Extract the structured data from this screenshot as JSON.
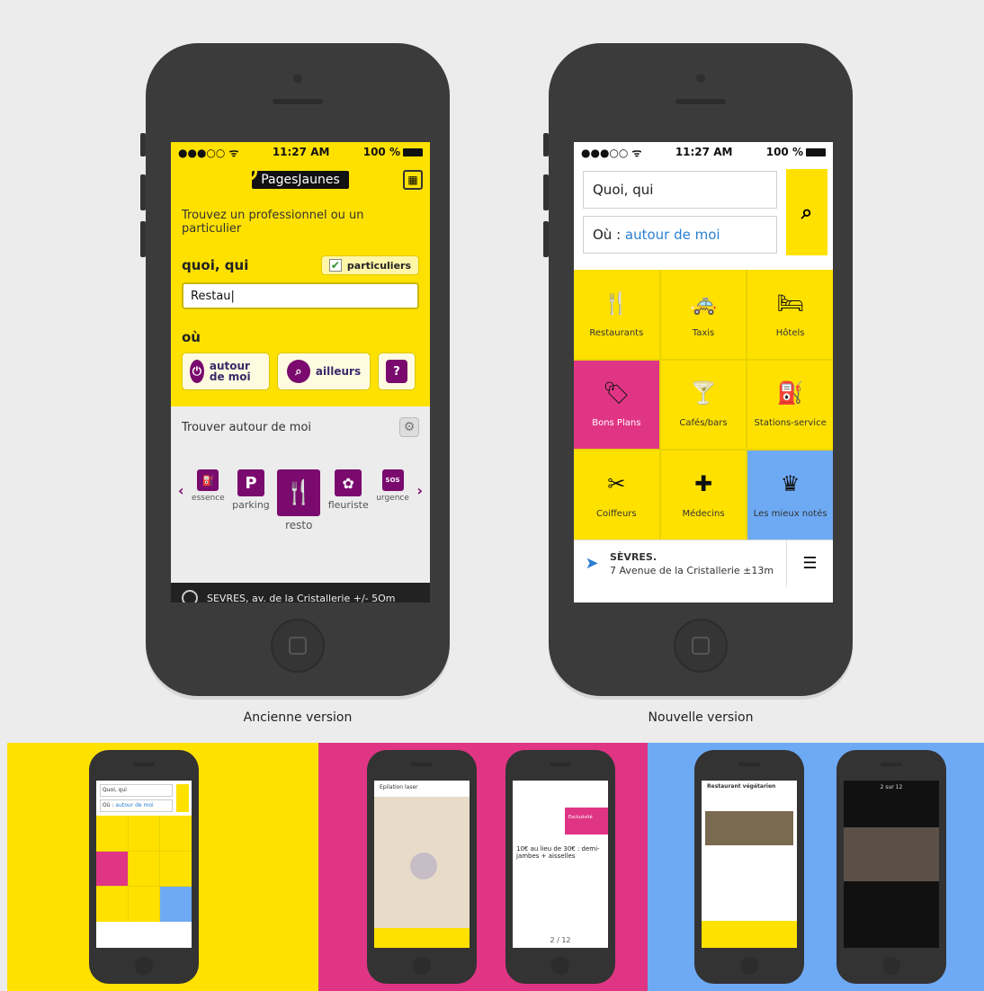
{
  "old_version": {
    "caption": "Ancienne version",
    "status": {
      "time": "11:27 AM",
      "battery": "100 %"
    },
    "logo": "PagesJaunes",
    "lead": "Trouvez un professionnel ou un particulier",
    "what_label": "quoi, qui",
    "checkbox_label": "particuliers",
    "query_value": "Restau",
    "where_label": "où",
    "buttons": [
      {
        "label": "autour de moi"
      },
      {
        "label": "ailleurs"
      },
      {
        "label": "?"
      }
    ],
    "nearby_title": "Trouver autour de moi",
    "categories": [
      {
        "label": "essence",
        "glyph": "⛽"
      },
      {
        "label": "parking",
        "glyph": "P"
      },
      {
        "label": "resto",
        "glyph": "🍴"
      },
      {
        "label": "fleuriste",
        "glyph": "✿"
      },
      {
        "label": "urgence",
        "glyph": "SOS"
      }
    ],
    "footer_location": "SEVRES, av. de la Cristallerie +/- 5Om"
  },
  "new_version": {
    "caption": "Nouvelle version",
    "status": {
      "time": "11:27 AM",
      "battery": "100 %"
    },
    "what_placeholder": "Quoi, qui",
    "where_prefix": "Où :",
    "where_value": "autour de moi",
    "tiles": [
      {
        "label": "Restaurants",
        "icon": "fork-knife-icon",
        "glyph": "🍴",
        "color": "#ffe100"
      },
      {
        "label": "Taxis",
        "icon": "taxi-icon",
        "glyph": "🚕",
        "color": "#ffe100"
      },
      {
        "label": "Hôtels",
        "icon": "bed-icon",
        "glyph": "🛏",
        "color": "#ffe100"
      },
      {
        "label": "Bons Plans",
        "icon": "tag-icon",
        "glyph": "🏷",
        "color": "#e03585"
      },
      {
        "label": "Cafés/bars",
        "icon": "cocktail-icon",
        "glyph": "🍸",
        "color": "#ffe100"
      },
      {
        "label": "Stations-service",
        "icon": "fuel-icon",
        "glyph": "⛽",
        "color": "#ffe100"
      },
      {
        "label": "Coiffeurs",
        "icon": "scissors-icon",
        "glyph": "✂",
        "color": "#ffe100"
      },
      {
        "label": "Médecins",
        "icon": "medkit-icon",
        "glyph": "✚",
        "color": "#ffe100"
      },
      {
        "label": "Les mieux notés",
        "icon": "crown-icon",
        "glyph": "♛",
        "color": "#6eaaf4"
      }
    ],
    "footer": {
      "city": "SÈVRES.",
      "address": "7 Avenue de la Cristallerie ±13m"
    }
  },
  "bottom": {
    "colors": {
      "yellow": "#ffe100",
      "pink": "#e03585",
      "blue": "#6eaaf4"
    },
    "mini_yellow": {
      "what": "Quoi, qui",
      "where_prefix": "Où :",
      "where_value": "autour de moi"
    },
    "mini_pink_1": {
      "title": "Epilation laser"
    },
    "mini_pink_2": {
      "tag": "Exclusivité",
      "offer": "10€ au lieu de 30€ : demi-jambes + aisselles",
      "pager": "2 / 12"
    },
    "mini_blue_1": {
      "title": "Restaurant végétarien"
    },
    "mini_blue_2": {
      "pager": "2 sur 12"
    }
  }
}
